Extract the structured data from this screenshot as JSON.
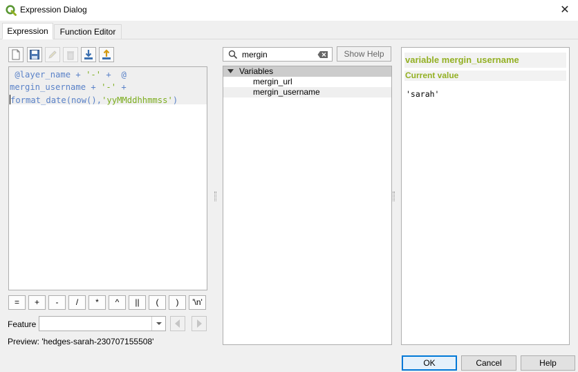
{
  "window": {
    "title": "Expression Dialog",
    "icon": "qgis-logo-icon"
  },
  "tabs": [
    {
      "label": "Expression",
      "active": true
    },
    {
      "label": "Function Editor",
      "active": false
    }
  ],
  "toolbar": {
    "items": [
      {
        "icon": "new-file-icon",
        "enabled": true
      },
      {
        "icon": "save-icon",
        "enabled": true
      },
      {
        "icon": "edit-icon",
        "enabled": false
      },
      {
        "icon": "delete-icon",
        "enabled": false
      },
      {
        "icon": "import-icon",
        "enabled": true
      },
      {
        "icon": "export-icon",
        "enabled": true
      }
    ]
  },
  "editor": {
    "line1": {
      "lead": " ",
      "var1": "@layer_name",
      "op1": " + ",
      "str1": "'-'",
      "op2": " +  ",
      "var2": "@"
    },
    "line2": {
      "var": "mergin_username",
      "op1": " + ",
      "str": "'-'",
      "op2": " +"
    },
    "line3": {
      "fn": "format_date(now(),",
      "str": "'yyMMddhhmmss'",
      "close": ")"
    }
  },
  "operators": [
    "=",
    "+",
    "-",
    "/",
    "*",
    "^",
    "||",
    "(",
    ")",
    "'\\n'"
  ],
  "feature": {
    "label": "Feature",
    "value": ""
  },
  "preview": {
    "text": "Preview:  'hedges-sarah-230707155508'"
  },
  "search": {
    "value": "mergin",
    "placeholder": "Search…"
  },
  "show_help_label": "Show Help",
  "tree": {
    "group": "Variables",
    "items": [
      {
        "label": "mergin_url",
        "selected": false
      },
      {
        "label": "mergin_username",
        "selected": true
      }
    ]
  },
  "help": {
    "title": "variable mergin_username",
    "subtitle": "Current value",
    "value": "'sarah'"
  },
  "buttons": {
    "ok": "OK",
    "cancel": "Cancel",
    "help": "Help"
  },
  "colors": {
    "accent_green": "#93b023",
    "variable_blue": "#5a82c8",
    "string_green": "#7cad1e",
    "focus_blue": "#0078d7"
  }
}
